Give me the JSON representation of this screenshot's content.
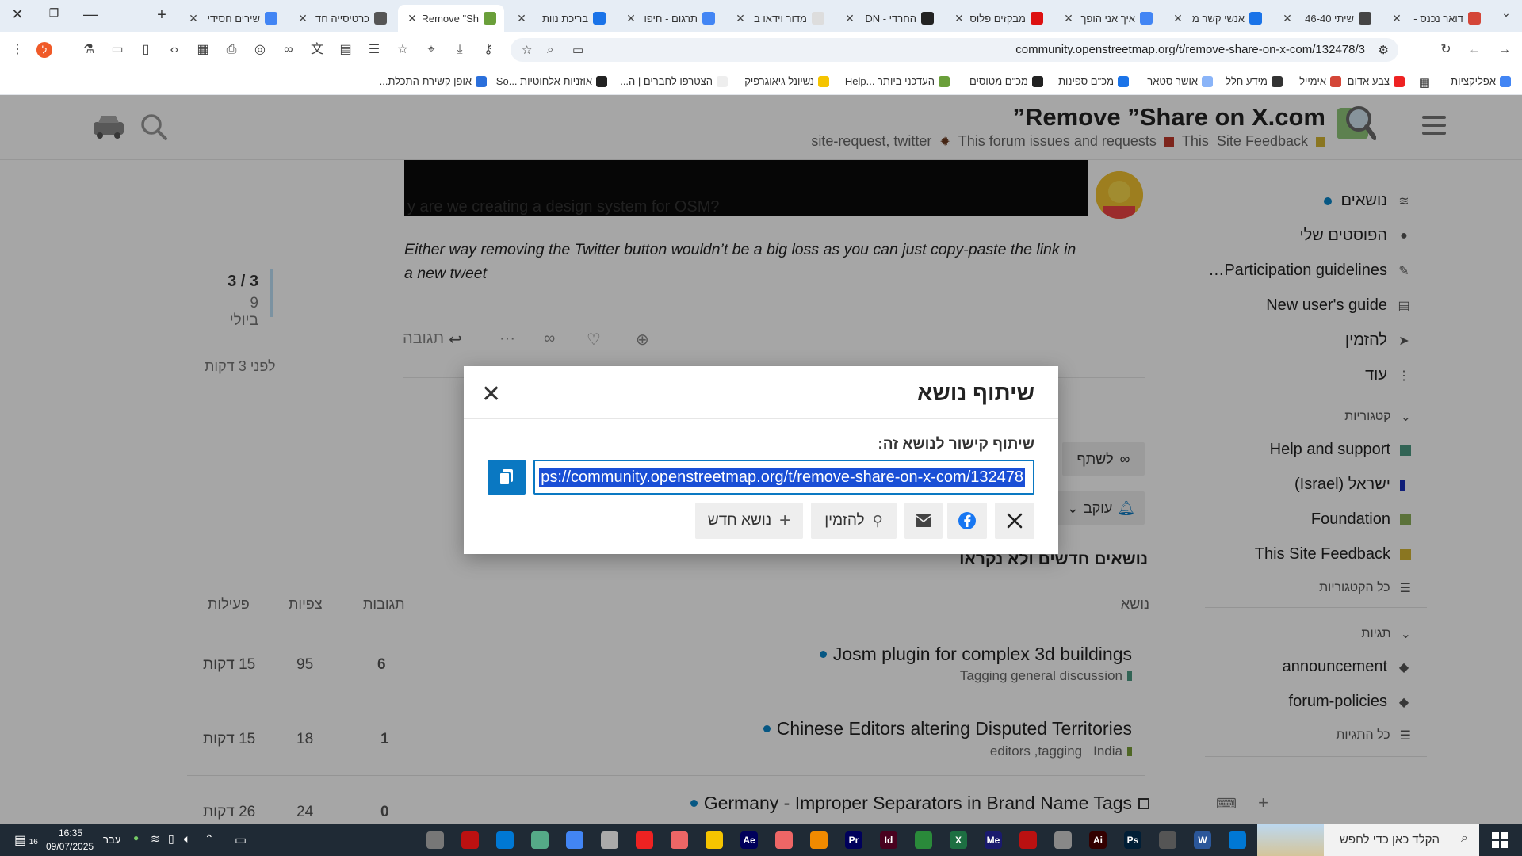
{
  "browser": {
    "tabs": [
      {
        "label": "דואר נכנס -",
        "fav": "#d44638"
      },
      {
        "label": "שיתי 46-40",
        "fav": "#444"
      },
      {
        "label": "אנשי קשר מ",
        "fav": "#1a73e8"
      },
      {
        "label": "איך אני הופך",
        "fav": "#4285f4"
      },
      {
        "label": "מבקזים פלוס",
        "fav": "#d11"
      },
      {
        "label": "החרדי - DN",
        "fav": "#222"
      },
      {
        "label": "מדור וידאו ב",
        "fav": "#ddd"
      },
      {
        "label": "תרגום - חיפו",
        "fav": "#4285f4"
      },
      {
        "label": "בריכת נוות",
        "fav": "#1a73e8"
      },
      {
        "label": "Remove \"Sh",
        "fav": "#6a9f3a"
      },
      {
        "label": "כרטיסייה חד",
        "fav": "#555"
      },
      {
        "label": "שירים חסידי",
        "fav": "#4285f4"
      }
    ],
    "url": "community.openstreetmap.org/t/remove-share-on-x-com/132478/3",
    "bookmarks": [
      {
        "label": "אפליקציות",
        "fav": "#4285f4"
      },
      {
        "label": "צבע אדום",
        "fav": "#e22"
      },
      {
        "label": "אימייל",
        "fav": "#d44638"
      },
      {
        "label": "מידע חלל",
        "fav": "#333"
      },
      {
        "label": "אושר סטאר",
        "fav": "#8ab4f8"
      },
      {
        "label": "מכ\"ם ספינות",
        "fav": "#1a73e8"
      },
      {
        "label": "מכ\"ם מטוסים",
        "fav": "#222"
      },
      {
        "label": "העדכני ביותר ...Help",
        "fav": "#6a9f3a"
      },
      {
        "label": "נשיונל גיאוגרפיק",
        "fav": "#f5c400"
      },
      {
        "label": "הצטרפו לחברים | ה...",
        "fav": "#eee"
      },
      {
        "label": "אוזניות אלחוטיות ...So",
        "fav": "#222"
      },
      {
        "label": "אופן קשירת התכלת...",
        "fav": "#2a6fdb"
      }
    ]
  },
  "site": {
    "topic_title": "Remove ”Share on X.com”",
    "category_feedback": "Site Feedback",
    "category_this": "This",
    "category_forum": "This forum issues and requests",
    "tags": "site-request, twitter"
  },
  "sidebar": {
    "items": [
      {
        "label": "נושאים",
        "icon": "layers-icon"
      },
      {
        "label": "הפוסטים שלי",
        "icon": "user-icon"
      },
      {
        "label": "Participation guidelines…",
        "icon": "pen-icon"
      },
      {
        "label": "New user's guide",
        "icon": "book-icon"
      },
      {
        "label": "להזמין",
        "icon": "paper-plane-icon"
      },
      {
        "label": "עוד",
        "icon": "more-vertical-icon"
      }
    ],
    "categories_heading": "קטגוריות",
    "categories": [
      {
        "label": "Help and support",
        "color": "#4d9a83"
      },
      {
        "label": "ישראל (Israel)",
        "color": "#1a2fb8"
      },
      {
        "label": "Foundation",
        "color": "#8cb05a"
      },
      {
        "label": "This Site Feedback",
        "color": "#d4b534"
      }
    ],
    "all_categories": "כל הקטגוריות",
    "tags_heading": "תגיות",
    "tags": [
      {
        "label": "announcement"
      },
      {
        "label": "forum-policies"
      }
    ],
    "all_tags": "כל התגיות"
  },
  "post": {
    "video_caption": "y are we creating a design system for OSM?",
    "text": "Either way removing the Twitter button wouldn’t be a big loss as you can just copy-paste the link in a new tweet",
    "reply_label": "תגובה"
  },
  "timeline": {
    "count": "3 / 3",
    "date": "9 ביולי",
    "ago": "לפני 3 דקות"
  },
  "topic_footer": {
    "share_label": "לשתף",
    "follow_label": "עוקב"
  },
  "new_topics": {
    "heading": "נושאים חדשים ולא נקראו",
    "col_topic": "נושא",
    "col_replies": "תגובות",
    "col_views": "צפיות",
    "col_activity": "פעילות",
    "rows": [
      {
        "title": "Josm plugin for complex 3d buildings",
        "sub": "Tagging general discussion",
        "sub_color": "#4d9a83",
        "replies": "6",
        "views": "95",
        "activity": "15 דקות"
      },
      {
        "title": "Chinese Editors altering Disputed Territories",
        "sub": "India",
        "sub_color": "#7a9f3a",
        "tags": "editors ,tagging",
        "replies": "1",
        "views": "18",
        "activity": "15 דקות"
      },
      {
        "title": "Germany - Improper Separators in Brand Name Tags",
        "sub": "",
        "sub_color": "#e33",
        "replies": "0",
        "views": "24",
        "activity": "26 דקות"
      }
    ]
  },
  "modal": {
    "title": "שיתוף נושא",
    "label": "שיתוף קישור לנושא זה:",
    "url": "https://community.openstreetmap.org/t/remove-share-on-x-com/132478",
    "url_visible": "ps://community.openstreetmap.org/t/remove-share-on-x-com/132478",
    "invite_label": "להזמין",
    "new_topic_label": "נושא חדש"
  },
  "taskbar": {
    "search_placeholder": "הקלד כאן כדי לחפש",
    "time": "16:35",
    "date": "09/07/2025",
    "lang": "עבר",
    "notif": "16",
    "apps": [
      {
        "label": "",
        "color": "#0078d4"
      },
      {
        "label": "W",
        "color": "#2b579a"
      },
      {
        "label": "",
        "color": "#555"
      },
      {
        "label": "Ps",
        "color": "#001e36"
      },
      {
        "label": "Ai",
        "color": "#330000"
      },
      {
        "label": "",
        "color": "#888"
      },
      {
        "label": "",
        "color": "#b11"
      },
      {
        "label": "Me",
        "color": "#1a1a6e"
      },
      {
        "label": "X",
        "color": "#1d6f42"
      },
      {
        "label": "",
        "color": "#2a8a3a"
      },
      {
        "label": "Id",
        "color": "#49021f"
      },
      {
        "label": "Pr",
        "color": "#00005b"
      },
      {
        "label": "",
        "color": "#f08a00"
      },
      {
        "label": "",
        "color": "#e66"
      },
      {
        "label": "Ae",
        "color": "#00005b"
      },
      {
        "label": "",
        "color": "#f5c400"
      },
      {
        "label": "",
        "color": "#e66"
      },
      {
        "label": "",
        "color": "#e22"
      },
      {
        "label": "",
        "color": "#aaa"
      },
      {
        "label": "",
        "color": "#4285f4"
      },
      {
        "label": "",
        "color": "#5a8"
      },
      {
        "label": "",
        "color": "#0078d4"
      },
      {
        "label": "",
        "color": "#b11"
      },
      {
        "label": "",
        "color": "#777"
      }
    ]
  }
}
